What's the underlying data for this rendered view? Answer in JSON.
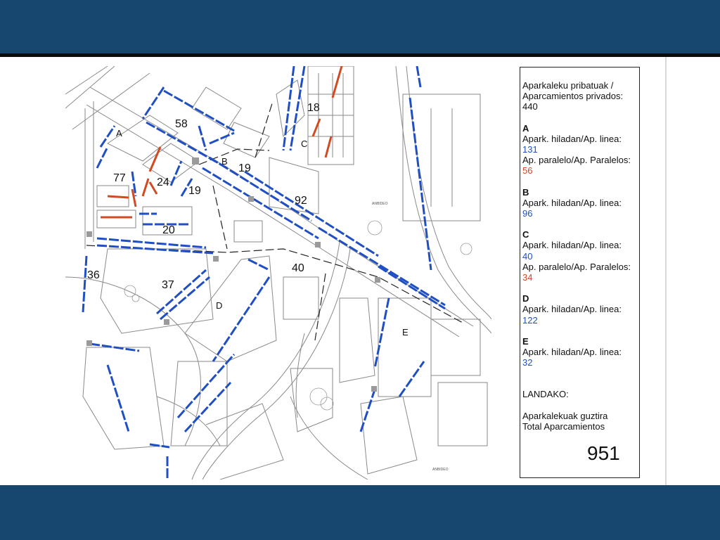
{
  "legend": {
    "header": "Aparkaleku pribatuak / Aparcamientos privados:",
    "header_value": "440",
    "sections": [
      {
        "letter": "A",
        "items": [
          {
            "label": "Apark. hiladan/Ap. linea:",
            "value": "131",
            "color": "blue"
          },
          {
            "label": "Ap. paralelo/Ap. Paralelos:",
            "value": "56",
            "color": "red"
          }
        ]
      },
      {
        "letter": "B",
        "items": [
          {
            "label": "Apark. hiladan/Ap. linea:",
            "value": "96",
            "color": "blue"
          }
        ]
      },
      {
        "letter": "C",
        "items": [
          {
            "label": "Apark. hiladan/Ap. linea:",
            "value": "40",
            "color": "blue"
          },
          {
            "label": "Ap. paralelo/Ap. Paralelos:",
            "value": "34",
            "color": "red"
          }
        ]
      },
      {
        "letter": "D",
        "items": [
          {
            "label": "Apark. hiladan/Ap. linea:",
            "value": "122",
            "color": "blue"
          }
        ]
      },
      {
        "letter": "E",
        "items": [
          {
            "label": "Apark. hiladan/Ap. linea:",
            "value": "32",
            "color": "blue"
          }
        ]
      }
    ],
    "landako": "LANDAKO:",
    "total_label_1": "Aparkalekuak guztira",
    "total_label_2": "Total Aparcamientos",
    "total_value": "951"
  },
  "map": {
    "zone_letters": [
      "A",
      "B",
      "C",
      "D",
      "E"
    ],
    "counts": [
      "58",
      "18",
      "77",
      "24",
      "19",
      "19",
      "92",
      "20",
      "36",
      "37",
      "40"
    ],
    "street_labels": [
      "ANBIDEO",
      "ANBIDEO"
    ]
  },
  "colors": {
    "band": "#17466f",
    "line_parking": "#1f4fc2",
    "parallel_parking": "#d24a22"
  }
}
